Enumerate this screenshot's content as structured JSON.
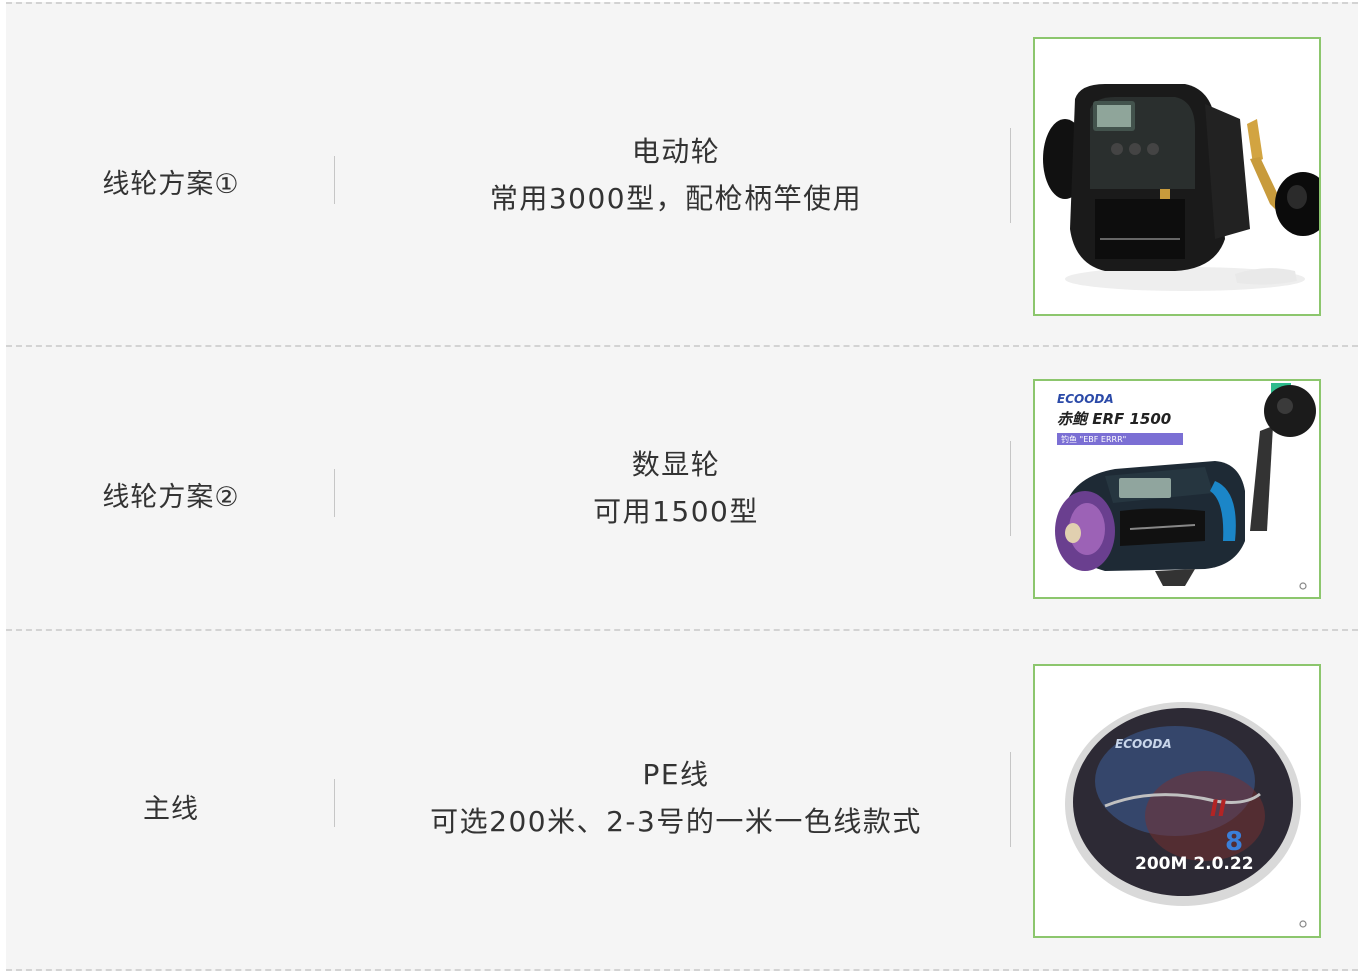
{
  "rows": [
    {
      "label": "线轮方案①",
      "title": "电动轮",
      "detail": "常用3000型，配枪柄竿使用",
      "image_icon": "electric-reel-image"
    },
    {
      "label": "线轮方案②",
      "title": "数显轮",
      "detail": "可用1500型",
      "image_icon": "digital-reel-image",
      "image_text": {
        "brand": "ECOODA",
        "model": "赤鲍 ERF 1500",
        "sub": "钓鱼 \"EBF ERRR\""
      }
    },
    {
      "label": "主线",
      "title": "PE线",
      "detail": "可选200米、2-3号的一米一色线款式",
      "image_icon": "pe-line-spool-image",
      "image_text": {
        "brand": "ECOODA",
        "badge": "8",
        "spec": "200M 2.0.22"
      }
    }
  ],
  "colors": {
    "row_bg": "#f5f5f5",
    "image_border": "#8cc66d",
    "divider": "#d3d3d3",
    "text": "#333333"
  }
}
